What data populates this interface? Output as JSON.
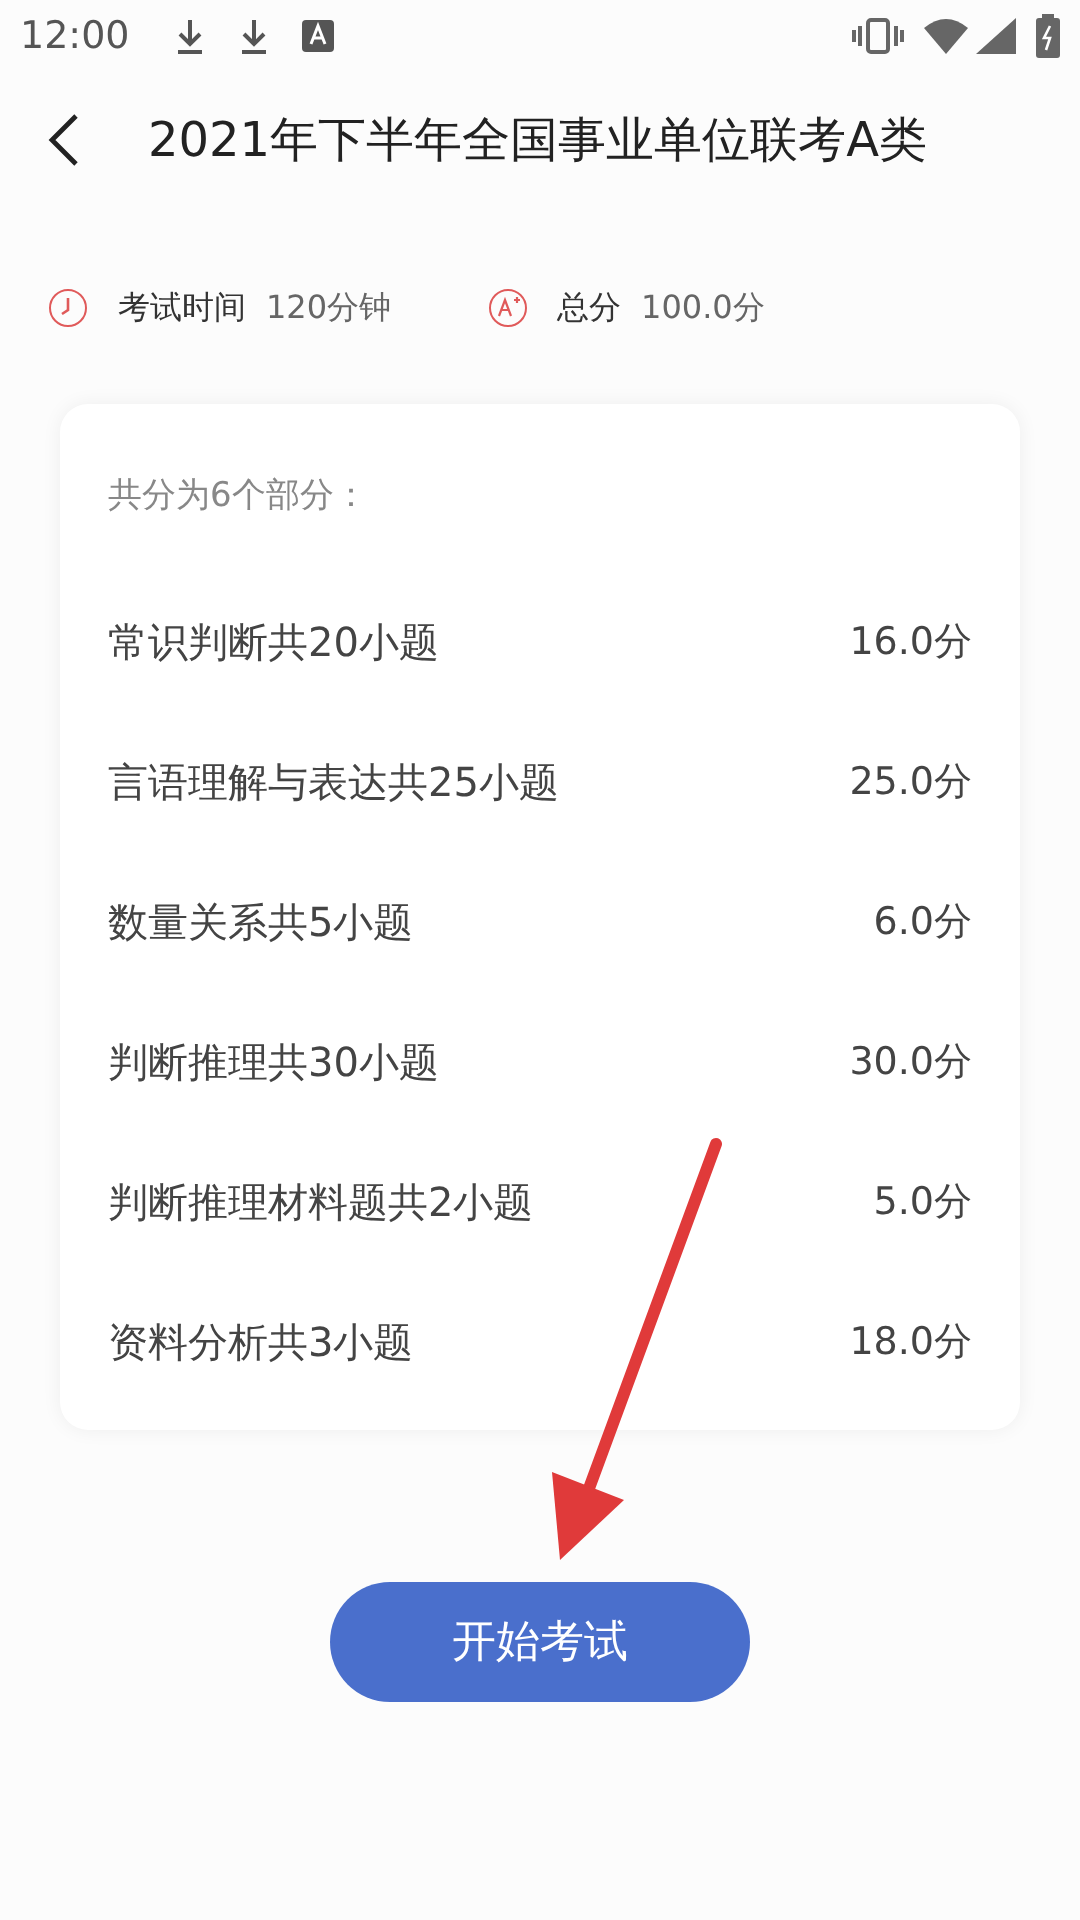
{
  "status_bar": {
    "time": "12:00"
  },
  "header": {
    "title": "2021年下半年全国事业单位联考A类"
  },
  "info": [
    {
      "kind": "time",
      "label": "考试时间",
      "value": "120分钟"
    },
    {
      "kind": "score",
      "label": "总分",
      "value": "100.0分"
    }
  ],
  "card": {
    "heading": "共分为6个部分：",
    "sections": [
      {
        "name": "常识判断共20小题",
        "score": "16.0分"
      },
      {
        "name": "言语理解与表达共25小题",
        "score": "25.0分"
      },
      {
        "name": "数量关系共5小题",
        "score": "6.0分"
      },
      {
        "name": "判断推理共30小题",
        "score": "30.0分"
      },
      {
        "name": "判断推理材料题共2小题",
        "score": "5.0分"
      },
      {
        "name": "资料分析共3小题",
        "score": "18.0分"
      }
    ]
  },
  "start_button": "开始考试"
}
